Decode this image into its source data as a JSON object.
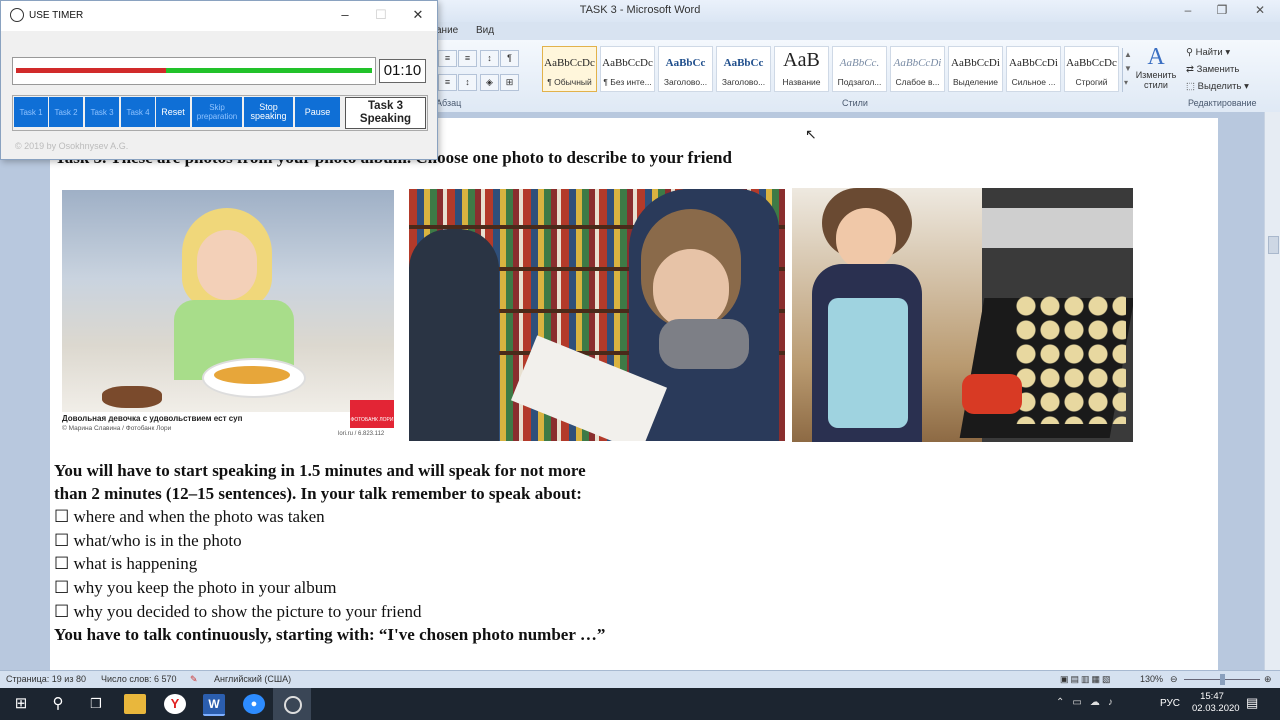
{
  "word": {
    "title": "TASK 3 - Microsoft Word",
    "tabs": [
      "ание",
      "Вид"
    ],
    "groups": {
      "paragraph": "Абзац",
      "styles": "Стили",
      "editing": "Редактирование"
    },
    "styles": [
      {
        "sample": "AaBbCcDc",
        "name": "¶ Обычный"
      },
      {
        "sample": "AaBbCcDc",
        "name": "¶ Без инте..."
      },
      {
        "sample": "AaBbCc",
        "name": "Заголово..."
      },
      {
        "sample": "AaBbCc",
        "name": "Заголово..."
      },
      {
        "sample": "AaB",
        "name": "Название"
      },
      {
        "sample": "AaBbCc.",
        "name": "Подзагол..."
      },
      {
        "sample": "AaBbCcDi",
        "name": "Слабое в..."
      },
      {
        "sample": "AaBbCcDi",
        "name": "Выделение"
      },
      {
        "sample": "AaBbCcDi",
        "name": "Сильное ..."
      },
      {
        "sample": "AaBbCcDc",
        "name": "Строгий"
      }
    ],
    "change_styles": "Изменить стили",
    "find": "Найти",
    "replace": "Заменить",
    "select": "Выделить",
    "status": {
      "page": "Страница: 19 из 80",
      "words": "Число слов: 6 570",
      "language": "Английский (США)",
      "zoom": "130%"
    }
  },
  "document": {
    "heading": "Task 3. These are photos from your photo album. Choose one photo to describe to your friend",
    "photo1_caption": "Довольная девочка с удовольствием ест суп",
    "photo1_credit": "© Марина Славина / Фотобанк Лори",
    "photo1_id": "lori.ru / 6.823.112",
    "photo1_logo": "ФОТОБАНК ЛОРИ",
    "intro_line1": "You will have to start speaking in 1.5 minutes and will speak for not more",
    "intro_line2": "than 2 minutes (12–15 sentences). In your talk remember to speak about:",
    "bullets": [
      "where and when the photo was taken",
      "what/who is in the photo",
      "what is happening",
      "why you keep the photo in your album",
      "why you decided to show the picture to your friend"
    ],
    "closing": "You have to talk continuously, starting with: “I've chosen photo number  …”"
  },
  "timer": {
    "title": "USE TIMER",
    "time": "01:10",
    "progress_red": 0.42,
    "buttons": [
      "Task 1",
      "Task 2",
      "Task 3",
      "Task 4",
      "Reset",
      "Skip preparation",
      "Stop speaking",
      "Pause"
    ],
    "current": "Task 3 Speaking",
    "copyright": "© 2019 by Osokhnysev A.G."
  },
  "taskbar": {
    "lang": "РУС",
    "time": "15:47",
    "date": "02.03.2020"
  }
}
